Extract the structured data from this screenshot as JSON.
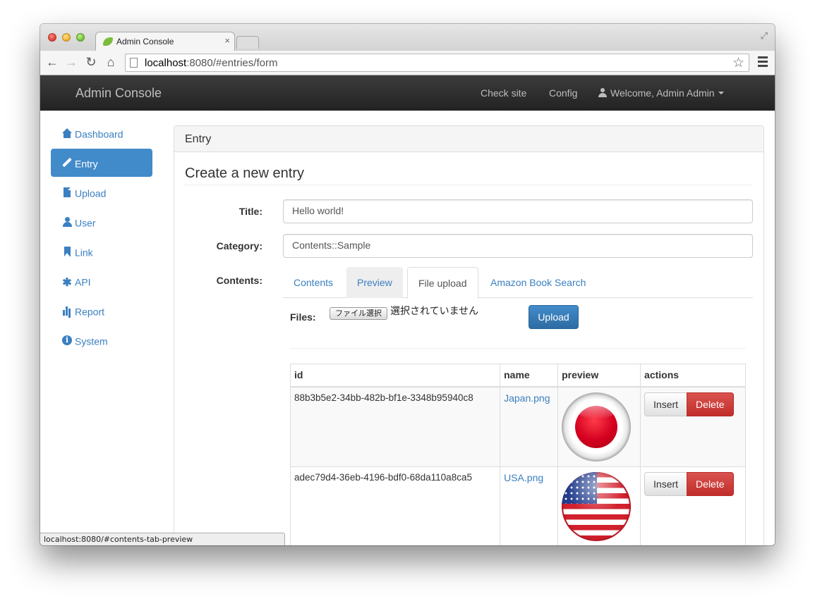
{
  "browser": {
    "tab_title": "Admin Console",
    "tab_close": "×",
    "url_host": "localhost",
    "url_rest": ":8080/#entries/form",
    "status_url": "localhost:8080/#contents-tab-preview"
  },
  "navbar": {
    "brand": "Admin Console",
    "links": [
      "Check site",
      "Config"
    ],
    "user_menu": "Welcome, Admin Admin"
  },
  "sidebar": {
    "items": [
      {
        "label": "Dashboard",
        "icon": "home-icon",
        "active": false
      },
      {
        "label": "Entry",
        "icon": "pencil-icon",
        "active": true
      },
      {
        "label": "Upload",
        "icon": "file-icon",
        "active": false
      },
      {
        "label": "User",
        "icon": "user-icon",
        "active": false
      },
      {
        "label": "Link",
        "icon": "bookmark-icon",
        "active": false
      },
      {
        "label": "API",
        "icon": "asterisk-icon",
        "active": false
      },
      {
        "label": "Report",
        "icon": "stats-icon",
        "active": false
      },
      {
        "label": "System",
        "icon": "info-icon",
        "active": false
      }
    ]
  },
  "panel": {
    "heading": "Entry",
    "page_title": "Create a new entry"
  },
  "form": {
    "title_label": "Title:",
    "title_value": "Hello world!",
    "category_label": "Category:",
    "category_value": "Contents::Sample",
    "contents_label": "Contents:",
    "tabs": [
      {
        "label": "Contents",
        "state": "default"
      },
      {
        "label": "Preview",
        "state": "hover"
      },
      {
        "label": "File upload",
        "state": "active"
      },
      {
        "label": "Amazon Book Search",
        "state": "default"
      }
    ]
  },
  "upload": {
    "files_label": "Files:",
    "choose_button": "ファイル選択",
    "no_file_text": "選択されていません",
    "upload_button": "Upload"
  },
  "files_table": {
    "columns": [
      "id",
      "name",
      "preview",
      "actions"
    ],
    "rows": [
      {
        "id": "88b3b5e2-34bb-482b-bf1e-3348b95940c8",
        "name": "Japan.png",
        "preview": "japan-flag",
        "insert": "Insert",
        "delete": "Delete"
      },
      {
        "id": "adec79d4-36eb-4196-bdf0-68da110a8ca5",
        "name": "USA.png",
        "preview": "usa-flag",
        "insert": "Insert",
        "delete": "Delete"
      }
    ]
  },
  "colors": {
    "primary": "#428bca",
    "danger": "#d9534f",
    "navbar": "#222222",
    "link": "#3a7fc1"
  }
}
